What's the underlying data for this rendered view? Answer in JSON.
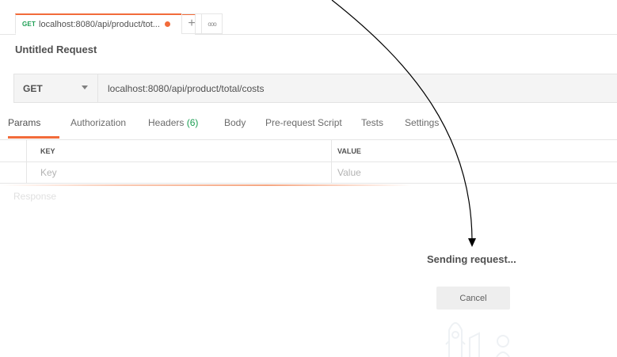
{
  "tab": {
    "method": "GET",
    "title": "localhost:8080/api/product/tot...",
    "unsaved_color": "#f26b3a",
    "add_icon": "plus-icon",
    "more_icon": "more-horizontal-icon",
    "add_symbol": "+",
    "more_symbol": "ooo"
  },
  "request": {
    "name": "Untitled Request",
    "method": "GET",
    "url": "localhost:8080/api/product/total/costs"
  },
  "subtabs": {
    "params": "Params",
    "authorization": "Authorization",
    "headers": "Headers",
    "headers_count": "(6)",
    "body": "Body",
    "prerequest": "Pre-request Script",
    "tests": "Tests",
    "settings": "Settings"
  },
  "params_table": {
    "key_header": "KEY",
    "value_header": "VALUE",
    "key_placeholder": "Key",
    "value_placeholder": "Value"
  },
  "response": {
    "label": "Response",
    "status_text": "Sending request...",
    "cancel_label": "Cancel"
  },
  "colors": {
    "accent": "#f26b3a",
    "method_get": "#1c9e53"
  }
}
